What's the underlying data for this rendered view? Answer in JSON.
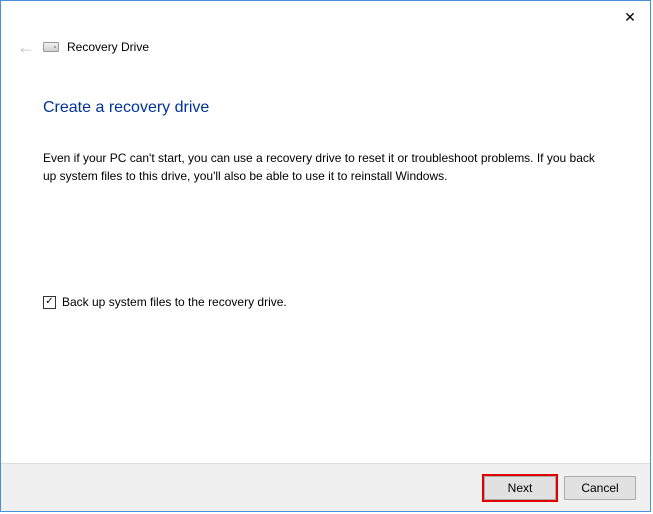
{
  "header": {
    "title": "Recovery Drive"
  },
  "content": {
    "heading": "Create a recovery drive",
    "description": "Even if your PC can't start, you can use a recovery drive to reset it or troubleshoot problems. If you back up system files to this drive, you'll also be able to use it to reinstall Windows."
  },
  "checkbox": {
    "label": "Back up system files to the recovery drive.",
    "checked": true
  },
  "footer": {
    "next": "Next",
    "cancel": "Cancel"
  }
}
